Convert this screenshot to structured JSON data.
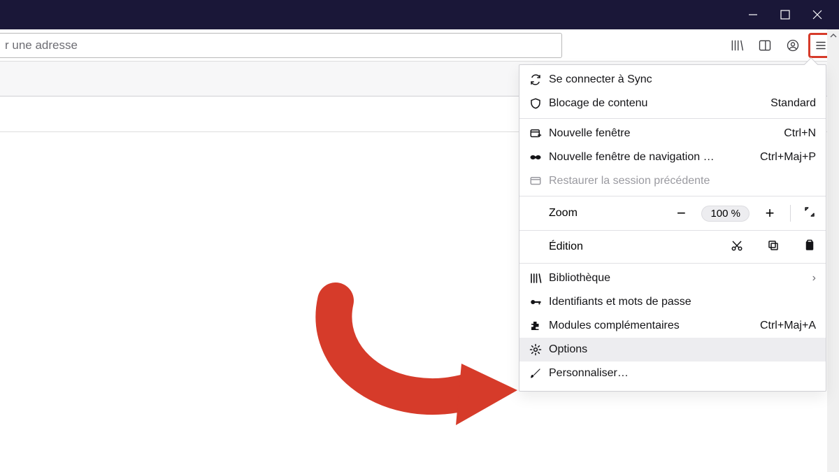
{
  "address_bar": {
    "placeholder": "r une adresse"
  },
  "menu": {
    "sync": "Se connecter à Sync",
    "content_blocking": {
      "label": "Blocage de contenu",
      "status": "Standard"
    },
    "new_window": {
      "label": "Nouvelle fenêtre",
      "accel": "Ctrl+N"
    },
    "private_window": {
      "label": "Nouvelle fenêtre de navigation …",
      "accel": "Ctrl+Maj+P"
    },
    "restore": "Restaurer la session précédente",
    "zoom": {
      "label": "Zoom",
      "value": "100 %"
    },
    "edition": "Édition",
    "library": "Bibliothèque",
    "logins": "Identifiants et mots de passe",
    "addons": {
      "label": "Modules complémentaires",
      "accel": "Ctrl+Maj+A"
    },
    "options": "Options",
    "customize": "Personnaliser…"
  }
}
